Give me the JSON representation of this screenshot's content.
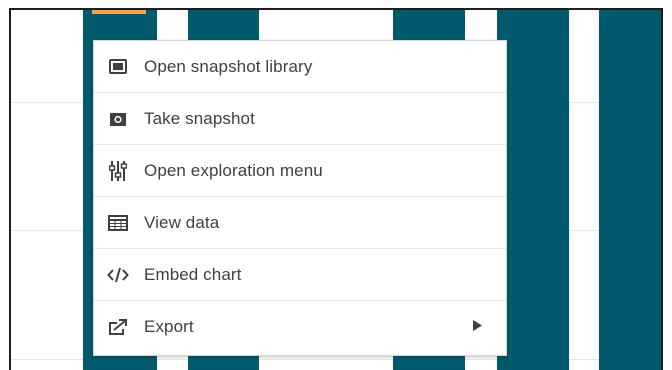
{
  "menu": {
    "items": [
      {
        "label": "Open snapshot library",
        "icon": "snapshot-library-icon"
      },
      {
        "label": "Take snapshot",
        "icon": "camera-icon"
      },
      {
        "label": "Open exploration menu",
        "icon": "sliders-icon"
      },
      {
        "label": "View data",
        "icon": "table-icon"
      },
      {
        "label": "Embed chart",
        "icon": "code-icon"
      },
      {
        "label": "Export",
        "icon": "export-icon",
        "has_submenu": true
      }
    ]
  },
  "colors": {
    "bar": "#005a6c",
    "accent": "#f1a24b",
    "text": "#404040",
    "icon": "#404040"
  }
}
